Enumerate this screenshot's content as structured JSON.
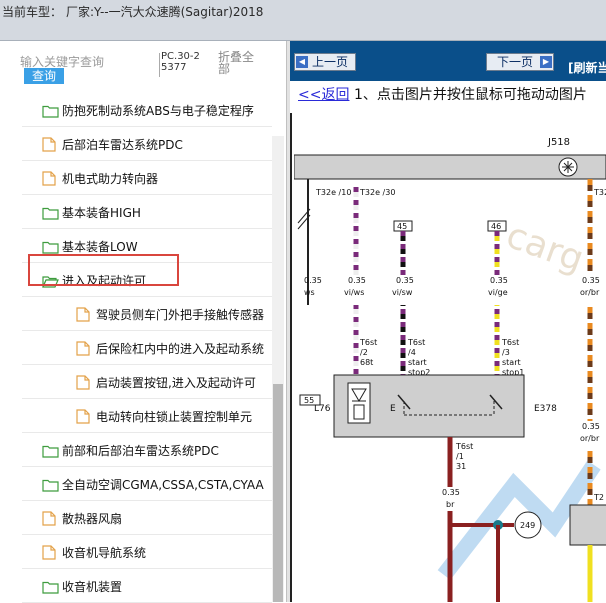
{
  "header": {
    "label": "当前车型：",
    "car": "厂家:Y--一汽大众速腾(Sagitar)2018"
  },
  "left": {
    "search_placeholder": "输入关键字查询",
    "search_button": "查询",
    "pc_code": "PC.30-25377",
    "fold_all": "折叠全部",
    "tree": [
      {
        "label": "防抱死制动系统ABS与电子稳定程序",
        "type": "folder",
        "level": 1
      },
      {
        "label": "后部泊车雷达系统PDC",
        "type": "file",
        "level": 1
      },
      {
        "label": "机电式助力转向器",
        "type": "file",
        "level": 1
      },
      {
        "label": "基本装备HIGH",
        "type": "folder",
        "level": 1
      },
      {
        "label": "基本装备LOW",
        "type": "folder",
        "level": 1
      },
      {
        "label": "进入及起动许可",
        "type": "folder-open",
        "level": 1
      },
      {
        "label": "驾驶员侧车门外把手接触传感器",
        "type": "file",
        "level": 2
      },
      {
        "label": "后保险杠内中的进入及起动系统",
        "type": "file",
        "level": 2
      },
      {
        "label": "启动装置按钮,进入及起动许可",
        "type": "file",
        "level": 2
      },
      {
        "label": "电动转向柱锁止装置控制单元",
        "type": "file",
        "level": 2
      },
      {
        "label": "前部和后部泊车雷达系统PDC",
        "type": "folder",
        "level": 1
      },
      {
        "label": "全自动空调CGMA,CSSA,CSTA,CYAA",
        "type": "folder",
        "level": 1
      },
      {
        "label": "散热器风扇",
        "type": "file",
        "level": 1
      },
      {
        "label": "收音机导航系统",
        "type": "file",
        "level": 1
      },
      {
        "label": "收音机装置",
        "type": "folder",
        "level": 1
      }
    ]
  },
  "right": {
    "prev_page": "上一页",
    "next_page": "下一页",
    "refresh": "[刷新当",
    "back_link": "<<返回",
    "instruction": "1、点击图片并按住鼠标可拖动动图片",
    "diagram": {
      "component_top": "J518",
      "connector_labels": [
        "T32e /10",
        "T32e /30",
        "T32"
      ],
      "wire_gauge": "0.35",
      "wire_colors": [
        "ws",
        "vi/ws",
        "vi/sw",
        "vi/ge",
        "or/br"
      ],
      "box_labels": [
        "45",
        "46",
        "55"
      ],
      "pin_labels": [
        {
          "a": "T6st",
          "b": "/2",
          "c": "68t"
        },
        {
          "a": "T6st",
          "b": "/4",
          "c": "start",
          "d": "stop2"
        },
        {
          "a": "T6st",
          "b": "/3",
          "c": "start",
          "d": "stop1"
        }
      ],
      "device_left": "L76",
      "device_e": "E",
      "device_right": "E378",
      "bottom_pin": {
        "a": "T6st",
        "b": "/1",
        "c": "31"
      },
      "bottom_gauge": "0.35",
      "bottom_color": "br",
      "ground": "249",
      "right_labels": [
        "0.35",
        "or/br",
        "T2"
      ],
      "watermark": "carg"
    }
  }
}
